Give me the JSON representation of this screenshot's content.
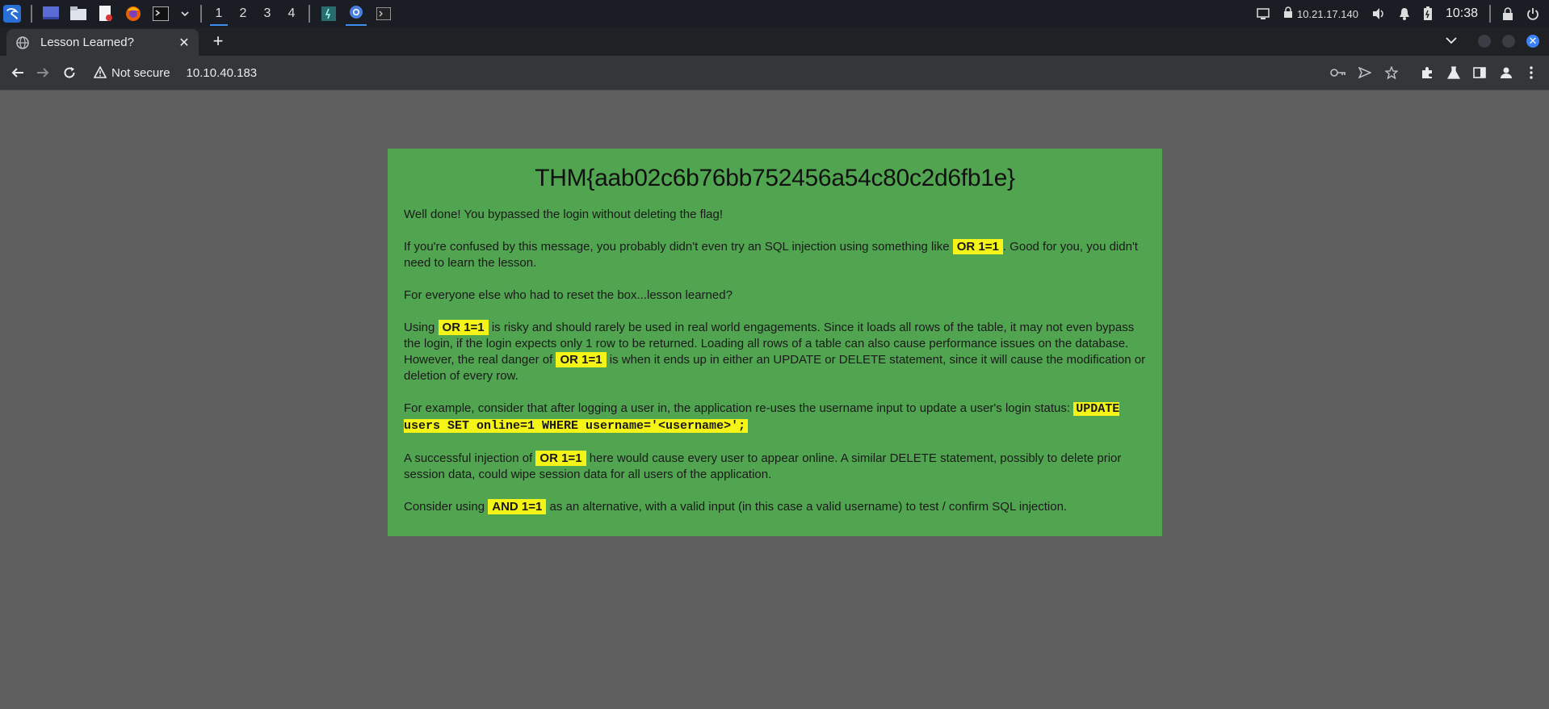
{
  "os_panel": {
    "workspaces": [
      "1",
      "2",
      "3",
      "4"
    ],
    "active_workspace": "1",
    "ip": "10.21.17.140",
    "clock": "10:38",
    "icons": [
      "kali-menu-icon",
      "desktop-icon",
      "files-icon",
      "text-editor-icon",
      "firefox-icon",
      "terminal-icon",
      "chevron-down-icon",
      "taskbar-app-icon",
      "chrome-icon",
      "terminal-window-icon",
      "display-icon",
      "vpn-icon",
      "volume-icon",
      "bell-icon",
      "battery-icon",
      "lock-icon",
      "power-icon"
    ]
  },
  "browser": {
    "tab_title": "Lesson Learned?",
    "security_label": "Not secure",
    "url": "10.10.40.183"
  },
  "page": {
    "heading": "THM{aab02c6b76bb752456a54c80c2d6fb1e}",
    "p1": "Well done! You bypassed the login without deleting the flag!",
    "p2_a": "If you're confused by this message, you probably didn't even try an SQL injection using something like ",
    "or_1_1": "OR 1=1",
    "p2_b": ". Good for you, you didn't need to learn the lesson.",
    "p3": "For everyone else who had to reset the box...lesson learned?",
    "p4_a": "Using ",
    "p4_b": " is risky and should rarely be used in real world engagements. Since it loads all rows of the table, it may not even bypass the login, if the login expects only 1 row to be returned. Loading all rows of a table can also cause performance issues on the database. However, the real danger of ",
    "p4_c": " is when it ends up in either an UPDATE or DELETE statement, since it will cause the modification or deletion of every row.",
    "p5_a": "For example, consider that after logging a user in, the application re-uses the username input to update a user's login status: ",
    "update_query": "UPDATE users SET online=1 WHERE username='<username>';",
    "p6_a": "A successful injection of ",
    "p6_b": " here would cause every user to appear online. A similar DELETE statement, possibly to delete prior session data, could wipe session data for all users of the application.",
    "p7_a": "Consider using ",
    "and_1_1": "AND 1=1",
    "p7_b": " as an alternative, with a valid input (in this case a valid username) to test / confirm SQL injection."
  },
  "colors": {
    "card_bg": "#51a551",
    "highlight": "#f4f416",
    "page_bg": "#5f5f5f"
  }
}
